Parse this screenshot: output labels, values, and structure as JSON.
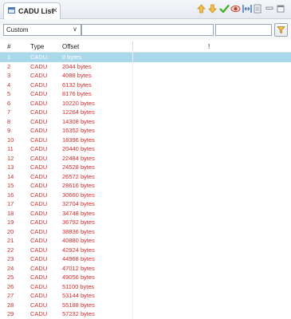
{
  "view": {
    "tab_label": "CADU List",
    "tab_close": "✕",
    "filter_combo_value": "Custom",
    "filter_combo_arrow": "∨",
    "search_value": "",
    "search2_value": ""
  },
  "toolbar_icons": [
    {
      "name": "arrow-up-icon",
      "color": "#e8a020"
    },
    {
      "name": "arrow-down-icon",
      "color": "#e8a020"
    },
    {
      "name": "checkmark-icon",
      "color": "#3fae2a"
    },
    {
      "name": "eye-icon",
      "color": "#d0402a"
    },
    {
      "name": "fit-columns-icon",
      "color": "#3a6fb0"
    },
    {
      "name": "document-icon",
      "color": "#7a8594"
    },
    {
      "name": "minimize-icon",
      "color": "#7a8594"
    },
    {
      "name": "maximize-icon",
      "color": "#7a8594"
    }
  ],
  "table": {
    "columns": [
      "#",
      "Type",
      "Offset",
      "!"
    ],
    "selected_row": 0,
    "text_color": "#c93030",
    "selection_color": "#a8d8ea",
    "rows": [
      {
        "n": "1",
        "type": "CADU",
        "offset": "0 bytes"
      },
      {
        "n": "2",
        "type": "CADU",
        "offset": "2044 bytes"
      },
      {
        "n": "3",
        "type": "CADU",
        "offset": "4088 bytes"
      },
      {
        "n": "4",
        "type": "CADU",
        "offset": "6132 bytes"
      },
      {
        "n": "5",
        "type": "CADU",
        "offset": "8176 bytes"
      },
      {
        "n": "6",
        "type": "CADU",
        "offset": "10220 bytes"
      },
      {
        "n": "7",
        "type": "CADU",
        "offset": "12264 bytes"
      },
      {
        "n": "8",
        "type": "CADU",
        "offset": "14308 bytes"
      },
      {
        "n": "9",
        "type": "CADU",
        "offset": "16352 bytes"
      },
      {
        "n": "10",
        "type": "CADU",
        "offset": "18396 bytes"
      },
      {
        "n": "11",
        "type": "CADU",
        "offset": "20440 bytes"
      },
      {
        "n": "12",
        "type": "CADU",
        "offset": "22484 bytes"
      },
      {
        "n": "13",
        "type": "CADU",
        "offset": "24528 bytes"
      },
      {
        "n": "14",
        "type": "CADU",
        "offset": "26572 bytes"
      },
      {
        "n": "15",
        "type": "CADU",
        "offset": "28616 bytes"
      },
      {
        "n": "16",
        "type": "CADU",
        "offset": "30660 bytes"
      },
      {
        "n": "17",
        "type": "CADU",
        "offset": "32704 bytes"
      },
      {
        "n": "18",
        "type": "CADU",
        "offset": "34748 bytes"
      },
      {
        "n": "19",
        "type": "CADU",
        "offset": "36792 bytes"
      },
      {
        "n": "20",
        "type": "CADU",
        "offset": "38836 bytes"
      },
      {
        "n": "21",
        "type": "CADU",
        "offset": "40880 bytes"
      },
      {
        "n": "22",
        "type": "CADU",
        "offset": "42924 bytes"
      },
      {
        "n": "23",
        "type": "CADU",
        "offset": "44968 bytes"
      },
      {
        "n": "24",
        "type": "CADU",
        "offset": "47012 bytes"
      },
      {
        "n": "25",
        "type": "CADU",
        "offset": "49056 bytes"
      },
      {
        "n": "26",
        "type": "CADU",
        "offset": "51100 bytes"
      },
      {
        "n": "27",
        "type": "CADU",
        "offset": "53144 bytes"
      },
      {
        "n": "28",
        "type": "CADU",
        "offset": "55188 bytes"
      },
      {
        "n": "29",
        "type": "CADU",
        "offset": "57232 bytes"
      }
    ]
  }
}
